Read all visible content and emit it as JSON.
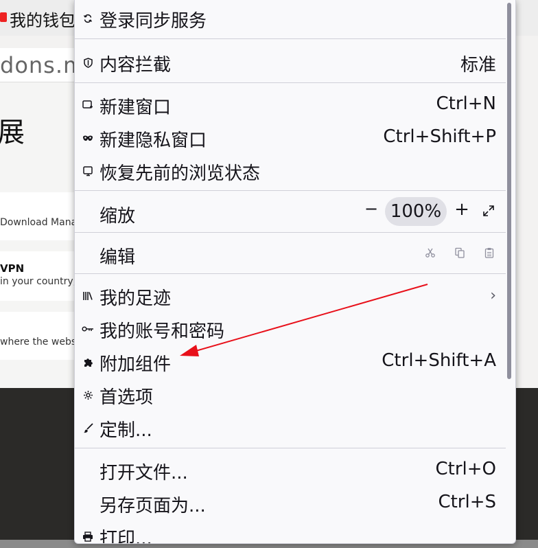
{
  "background": {
    "tab_title": "我的钱包",
    "url_fragment": "dons.m",
    "page_heading": "展",
    "cards": [
      {
        "text": "Download Manag"
      },
      {
        "title": "VPN",
        "text": "in your country,"
      },
      {
        "text": "where the websit"
      }
    ]
  },
  "menu": {
    "sync": {
      "label": "登录同步服务",
      "icon": "sync-icon"
    },
    "content_blocking": {
      "label": "内容拦截",
      "value": "标准",
      "icon": "shield-icon"
    },
    "new_window": {
      "label": "新建窗口",
      "shortcut": "Ctrl+N",
      "icon": "new-window-icon"
    },
    "private_window": {
      "label": "新建隐私窗口",
      "shortcut": "Ctrl+Shift+P",
      "icon": "private-mask-icon"
    },
    "restore_session": {
      "label": "恢复先前的浏览状态",
      "icon": "restore-session-icon"
    },
    "zoom": {
      "label": "缩放",
      "minus": "−",
      "value": "100%",
      "plus": "+"
    },
    "edit": {
      "label": "编辑"
    },
    "library": {
      "label": "我的足迹",
      "icon": "library-icon",
      "chevron": "›"
    },
    "logins": {
      "label": "我的账号和密码",
      "icon": "key-icon"
    },
    "addons": {
      "label": "附加组件",
      "shortcut": "Ctrl+Shift+A",
      "icon": "puzzle-icon"
    },
    "preferences": {
      "label": "首选项",
      "icon": "gear-icon"
    },
    "customize": {
      "label": "定制...",
      "icon": "paintbrush-icon"
    },
    "open_file": {
      "label": "打开文件...",
      "shortcut": "Ctrl+O"
    },
    "save_page": {
      "label": "另存页面为...",
      "shortcut": "Ctrl+S"
    },
    "print": {
      "label": "打印...",
      "icon": "printer-icon"
    }
  },
  "colors": {
    "menu_bg": "#f9f9fb",
    "annotation_arrow": "#e8101a",
    "separator": "#cfcfd8"
  }
}
